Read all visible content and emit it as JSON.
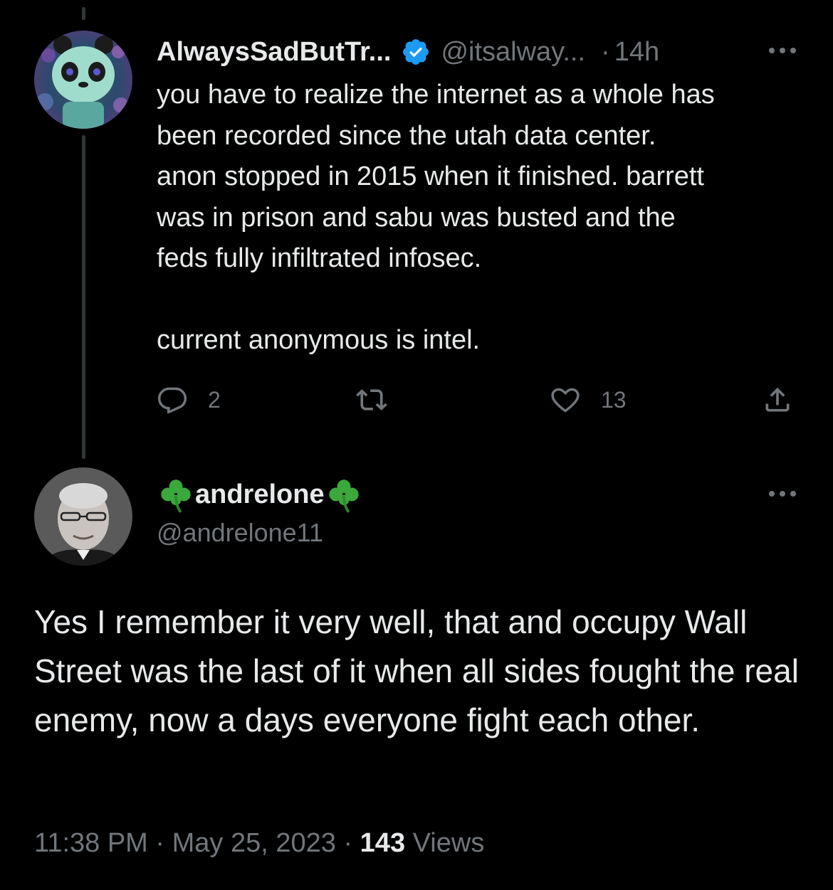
{
  "parent_tweet": {
    "display_name": "AlwaysSadButTr...",
    "handle": "@itsalway...",
    "separator": "·",
    "time_ago": "14h",
    "verified": true,
    "avatar_icon": "panda-avatar",
    "text_lines": [
      "you have to realize the internet as a whole has",
      "been recorded since the utah data center.",
      "anon stopped in 2015 when it finished. barrett",
      "was in prison and sabu was busted and the",
      "feds fully infiltrated infosec."
    ],
    "text_after_break": "current anonymous is intel.",
    "actions": {
      "reply_count": "2",
      "retweet_count": "",
      "like_count": "13"
    }
  },
  "main_tweet": {
    "display_name": "andrelone",
    "name_emoji": "shamrock-icon",
    "handle": "@andrelone11",
    "avatar_icon": "person-photo-avatar",
    "text": "Yes I remember it very well, that and occupy Wall Street was the last of it when all sides fought the real enemy, now a days everyone fight each other.",
    "timestamp_time": "11:38 PM",
    "separator": "·",
    "timestamp_date": "May 25, 2023",
    "views_count": "143",
    "views_label": "Views"
  },
  "colors": {
    "background": "#000000",
    "text_primary": "#e7e9ea",
    "text_secondary": "#71767b",
    "verified_blue": "#1d9bf0",
    "clover_green": "#3aa83a",
    "thread_line": "#333639"
  }
}
